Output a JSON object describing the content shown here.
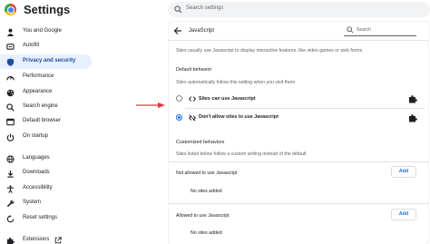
{
  "app": {
    "title": "Settings"
  },
  "search": {
    "placeholder": "Search settings"
  },
  "sidebar": {
    "items": [
      {
        "label": "You and Google",
        "icon": "person-icon"
      },
      {
        "label": "Autofill",
        "icon": "autofill-icon"
      },
      {
        "label": "Privacy and security",
        "icon": "shield-icon",
        "active": true
      },
      {
        "label": "Performance",
        "icon": "speedometer-icon"
      },
      {
        "label": "Appearance",
        "icon": "palette-icon"
      },
      {
        "label": "Search engine",
        "icon": "search-icon"
      },
      {
        "label": "Default browser",
        "icon": "browser-icon"
      },
      {
        "label": "On startup",
        "icon": "power-icon"
      },
      {
        "label": "Languages",
        "icon": "globe-icon"
      },
      {
        "label": "Downloads",
        "icon": "download-icon"
      },
      {
        "label": "Accessibility",
        "icon": "accessibility-icon"
      },
      {
        "label": "System",
        "icon": "wrench-icon"
      },
      {
        "label": "Reset settings",
        "icon": "reset-icon"
      },
      {
        "label": "Extensions",
        "icon": "puzzle-icon"
      }
    ]
  },
  "page": {
    "title": "JavaScript",
    "search_placeholder": "Search",
    "description": "Sites usually use Javascript to display interactive features, like video games or web forms",
    "default_behavior": {
      "heading": "Default behavior",
      "subtext": "Sites automatically follow this setting when you visit them",
      "options": [
        {
          "label": "Sites can use Javascript",
          "selected": false,
          "icon": "code-icon"
        },
        {
          "label": "Don't allow sites to use Javascript",
          "selected": true,
          "icon": "code-off-icon"
        }
      ]
    },
    "customized": {
      "heading": "Customized behaviors",
      "subtext": "Sites listed below follow a custom setting instead of the default",
      "not_allowed": {
        "label": "Not allowed to use Javascript",
        "add": "Add",
        "empty": "No sites added"
      },
      "allowed": {
        "label": "Allowed to use Javascript",
        "add": "Add",
        "empty": "No sites added"
      }
    }
  },
  "colors": {
    "accent": "#1a73e8",
    "active_bg": "#e8f0fe",
    "arrow": "#e53935"
  }
}
